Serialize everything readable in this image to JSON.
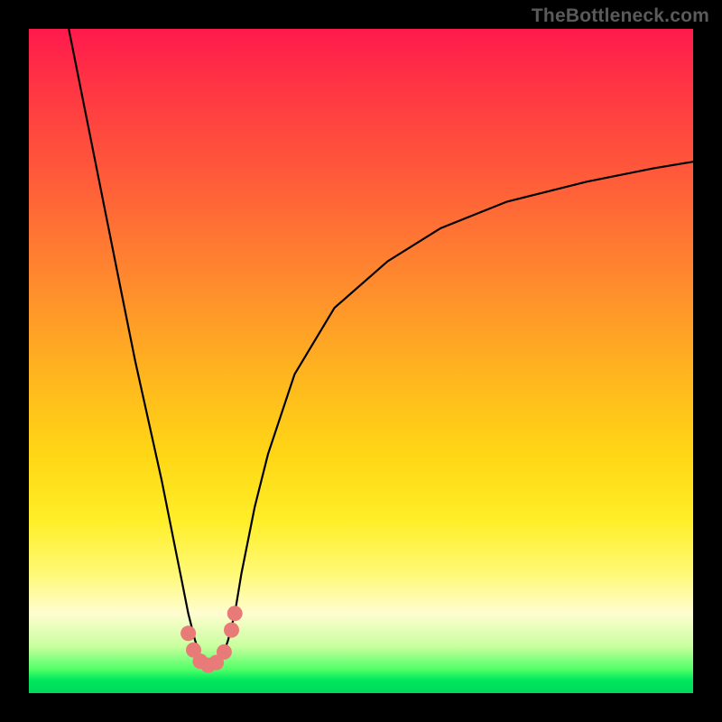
{
  "watermark": "TheBottleneck.com",
  "chart_data": {
    "type": "line",
    "title": "",
    "xlabel": "",
    "ylabel": "",
    "xlim": [
      0,
      100
    ],
    "ylim": [
      0,
      100
    ],
    "series": [
      {
        "name": "curve",
        "x": [
          6,
          8,
          10,
          12,
          14,
          16,
          18,
          20,
          22,
          23,
          24,
          25,
          26,
          27,
          28,
          29,
          30,
          31,
          32,
          34,
          36,
          40,
          46,
          54,
          62,
          72,
          84,
          94,
          100
        ],
        "y": [
          100,
          90,
          80,
          70,
          60,
          50,
          41,
          32,
          22,
          17,
          12,
          8,
          5,
          4,
          4,
          5,
          8,
          12,
          18,
          28,
          36,
          48,
          58,
          65,
          70,
          74,
          77,
          79,
          80
        ]
      }
    ],
    "markers": [
      {
        "x": 24.0,
        "y": 9.0
      },
      {
        "x": 24.8,
        "y": 6.5
      },
      {
        "x": 25.8,
        "y": 4.8
      },
      {
        "x": 27.0,
        "y": 4.2
      },
      {
        "x": 28.2,
        "y": 4.6
      },
      {
        "x": 29.4,
        "y": 6.2
      },
      {
        "x": 30.5,
        "y": 9.5
      },
      {
        "x": 31.0,
        "y": 12.0
      }
    ],
    "gradient_stops": [
      {
        "pos": 0.0,
        "color": "#ff1a4d"
      },
      {
        "pos": 0.5,
        "color": "#ffb51f"
      },
      {
        "pos": 0.8,
        "color": "#ffee28"
      },
      {
        "pos": 0.96,
        "color": "#4dff66"
      },
      {
        "pos": 1.0,
        "color": "#00d85a"
      }
    ]
  }
}
